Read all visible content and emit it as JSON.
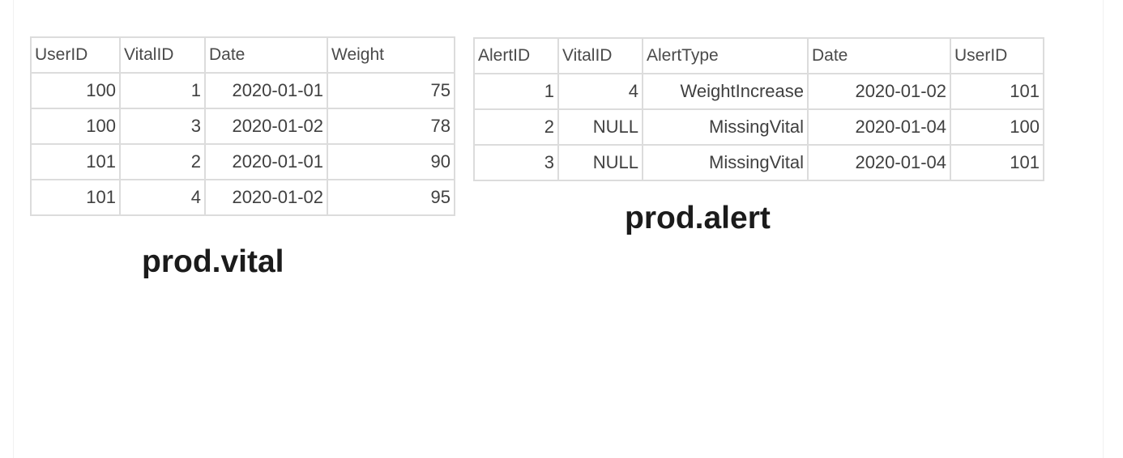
{
  "vital": {
    "caption": "prod.vital",
    "columns": [
      "UserID",
      "VitalID",
      "Date",
      "Weight"
    ],
    "rows": [
      [
        "100",
        "1",
        "2020-01-01",
        "75"
      ],
      [
        "100",
        "3",
        "2020-01-02",
        "78"
      ],
      [
        "101",
        "2",
        "2020-01-01",
        "90"
      ],
      [
        "101",
        "4",
        "2020-01-02",
        "95"
      ]
    ]
  },
  "alert": {
    "caption": "prod.alert",
    "columns": [
      "AlertID",
      "VitalID",
      "AlertType",
      "Date",
      "UserID"
    ],
    "rows": [
      [
        "1",
        "4",
        "WeightIncrease",
        "2020-01-02",
        "101"
      ],
      [
        "2",
        "NULL",
        "MissingVital",
        "2020-01-04",
        "100"
      ],
      [
        "3",
        "NULL",
        "MissingVital",
        "2020-01-04",
        "101"
      ]
    ]
  }
}
